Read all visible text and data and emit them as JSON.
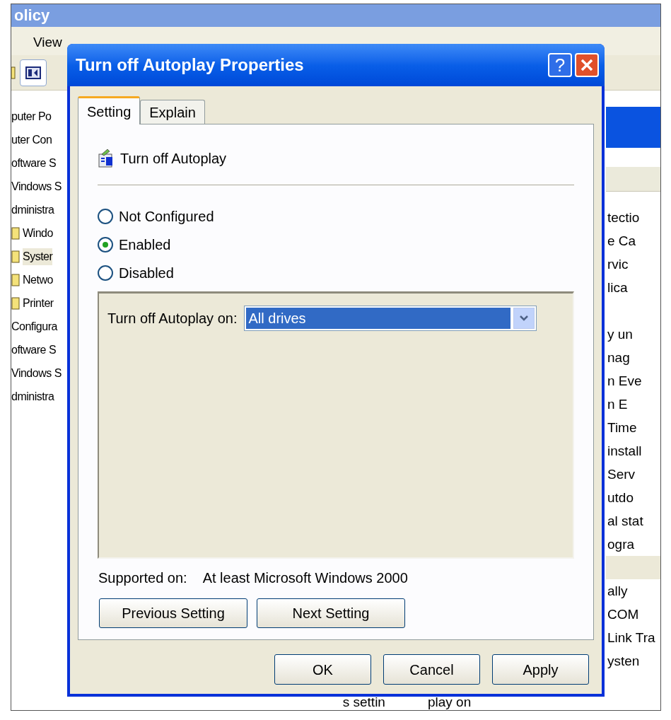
{
  "background_window": {
    "title": "olicy",
    "menu": [
      "View"
    ],
    "tree": [
      {
        "text": "puter Po",
        "children": [
          {
            "text": "uter Con",
            "children": [
              {
                "text": "oftware S"
              },
              {
                "text": "Vindows S"
              },
              {
                "text": "dministra",
                "children": [
                  {
                    "text": "Windo",
                    "selected": false
                  },
                  {
                    "text": "Syster",
                    "selected": true
                  },
                  {
                    "text": "Netwo",
                    "selected": false
                  },
                  {
                    "text": "Printer",
                    "selected": false
                  }
                ]
              }
            ]
          },
          {
            "text": "Configura",
            "children": [
              {
                "text": "oftware S"
              },
              {
                "text": "Vindows S"
              },
              {
                "text": "dministra"
              }
            ]
          }
        ]
      }
    ],
    "list_rows": [
      {
        "text": "tectio",
        "selected": false
      },
      {
        "text": "e Ca",
        "selected": false
      },
      {
        "text": "rvic",
        "selected": false
      },
      {
        "text": "lica",
        "selected": false
      },
      {
        "selected": false
      },
      {
        "text": "y un",
        "selected": false
      },
      {
        "text": "nag",
        "selected": false
      },
      {
        "text": "n Eve",
        "selected": false
      },
      {
        "text": "n E",
        "selected": false
      },
      {
        "text": "Time",
        "selected": false
      },
      {
        "text": "install",
        "selected": false
      },
      {
        "text": "Serv",
        "selected": false
      },
      {
        "text": "utdo",
        "selected": false
      },
      {
        "text": "al stat",
        "selected": false
      },
      {
        "text": "ogra",
        "selected": false
      },
      {
        "selected": true
      },
      {
        "text": "ally",
        "selected": false
      },
      {
        "text": "COM",
        "selected": false
      },
      {
        "text": "Link Tra",
        "selected": false
      },
      {
        "text": "ysten",
        "selected": false
      }
    ],
    "footer_fragments": [
      "s settin",
      "play on"
    ]
  },
  "dialog": {
    "title": "Turn off Autoplay Properties",
    "help_button": "?",
    "tabs": [
      {
        "label": "Setting",
        "selected": true
      },
      {
        "label": "Explain",
        "selected": false
      }
    ],
    "policy_name": "Turn off Autoplay",
    "options": [
      {
        "label": "Not Configured",
        "selected": false
      },
      {
        "label": "Enabled",
        "selected": true
      },
      {
        "label": "Disabled",
        "selected": false
      }
    ],
    "dropdown": {
      "label": "Turn off Autoplay on:",
      "value": "All drives"
    },
    "supported": {
      "label": "Supported on:",
      "value": "At least Microsoft Windows 2000"
    },
    "nav_buttons": [
      "Previous Setting",
      "Next Setting"
    ],
    "buttons": [
      "OK",
      "Cancel",
      "Apply"
    ]
  }
}
